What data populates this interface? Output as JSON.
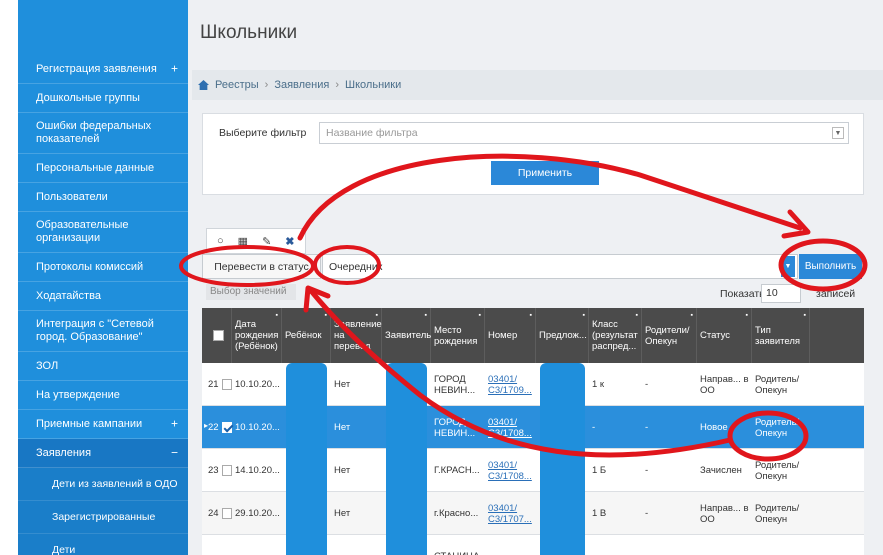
{
  "sidebar": {
    "items": [
      {
        "label": "Регистрация заявления",
        "plus": "+",
        "h": 29
      },
      {
        "label": "Дошкольные группы",
        "plus": "",
        "h": 29
      },
      {
        "label": "Ошибки федеральных показателей",
        "plus": "",
        "h": 41
      },
      {
        "label": "Персональные данные",
        "plus": "",
        "h": 29
      },
      {
        "label": "Пользователи",
        "plus": "",
        "h": 29
      },
      {
        "label": "Образовательные организации",
        "plus": "",
        "h": 41
      },
      {
        "label": "Протоколы комиссий",
        "plus": "",
        "h": 29
      },
      {
        "label": "Ходатайства",
        "plus": "",
        "h": 29
      },
      {
        "label": "Интеграция с \"Сетевой город. Образование\"",
        "plus": "",
        "h": 41
      },
      {
        "label": "ЗОЛ",
        "plus": "",
        "h": 29
      },
      {
        "label": "На утверждение",
        "plus": "",
        "h": 29
      },
      {
        "label": "Приемные кампании",
        "plus": "+",
        "h": 29
      },
      {
        "label": "Заявления",
        "plus": "−",
        "h": 29
      }
    ],
    "sub_items": [
      {
        "label": "Дети из заявлений в ОДО"
      },
      {
        "label": "Зарегистрированные"
      },
      {
        "label": "Дети"
      }
    ]
  },
  "page": {
    "title": "Школьники",
    "breadcrumb": [
      "Реестры",
      "Заявления",
      "Школьники"
    ],
    "breadcrumb_sep": "›"
  },
  "filter": {
    "label": "Выберите фильтр",
    "placeholder": "Название фильтра",
    "apply_label": "Применить"
  },
  "toolbar": {
    "icons": [
      "copy-icon",
      "grid-icon",
      "edit-icon",
      "close-icon"
    ],
    "glyphs": [
      "○",
      "▦",
      "✎",
      "✖"
    ]
  },
  "status_bar": {
    "status_button": "Перевести в статус",
    "status_value": "Очередник",
    "run_label": "Выполнить"
  },
  "under_button": "Выбор значений",
  "paging": {
    "show_label": "Показать",
    "show_value": "10",
    "show_tail": "записей"
  },
  "table": {
    "columns": [
      {
        "label": "",
        "w": 30
      },
      {
        "label": "Дата рождения (Ребёнок)",
        "w": 50
      },
      {
        "label": "Ребёнок",
        "w": 49
      },
      {
        "label": "Заявление на перевод",
        "w": 51
      },
      {
        "label": "Заявитель",
        "w": 49
      },
      {
        "label": "Место рождения",
        "w": 54
      },
      {
        "label": "Номер",
        "w": 51
      },
      {
        "label": "Предлож...",
        "w": 53
      },
      {
        "label": "Класс (результат распред...",
        "w": 53
      },
      {
        "label": "Родители/Опекун",
        "w": 55
      },
      {
        "label": "Статус",
        "w": 55
      },
      {
        "label": "Тип заявителя",
        "w": 58
      }
    ],
    "rows": [
      {
        "num": "21",
        "checked": false,
        "selected": false,
        "cells": [
          "10.10.20...",
          "",
          "Нет",
          "",
          "ГОРОД НЕВИН...",
          "03401/ С3/1709...",
          "",
          "1 к",
          "-",
          "Направ... в ОО",
          "Родитель/ Опекун"
        ]
      },
      {
        "num": "22",
        "checked": true,
        "selected": true,
        "cells": [
          "10.10.20...",
          "",
          "Нет",
          "",
          "ГОРОД НЕВИН...",
          "03401/ С3/1708...",
          "",
          "-",
          "-",
          "Новое",
          "Родитель/ Опекун"
        ]
      },
      {
        "num": "23",
        "checked": false,
        "selected": false,
        "cells": [
          "14.10.20...",
          "",
          "Нет",
          "",
          "Г.КРАСН...",
          "03401/ С3/1708...",
          "",
          "1 Б",
          "-",
          "Зачислен",
          "Родитель/ Опекун"
        ]
      },
      {
        "num": "24",
        "checked": false,
        "selected": false,
        "cells": [
          "29.10.20...",
          "",
          "Нет",
          "",
          "г.Красно...",
          "03401/ С3/1707...",
          "",
          "1 В",
          "-",
          "Направ... в ОО",
          "Родитель/ Опекун"
        ]
      },
      {
        "num": "",
        "checked": false,
        "selected": false,
        "cells": [
          "",
          "",
          "",
          "",
          "СТАНИЦА",
          "",
          "",
          "",
          "",
          "",
          ""
        ]
      }
    ]
  },
  "colors": {
    "sidebar": "#1f8fdc",
    "accent": "#2b88d8",
    "annotation": "#e0161c",
    "mask": "#1f8fdc"
  }
}
